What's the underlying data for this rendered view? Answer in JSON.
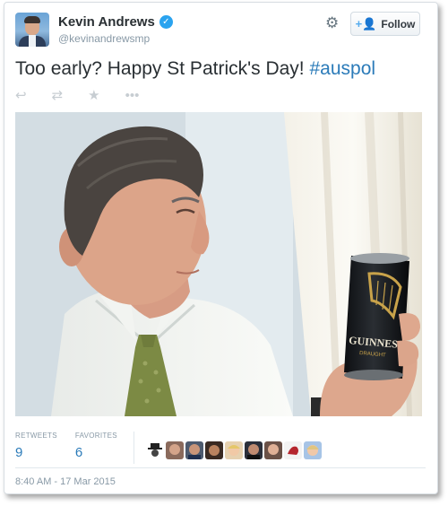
{
  "author": {
    "display_name": "Kevin Andrews",
    "handle": "@kevinandrewsmp",
    "verified_icon": "verified-badge-icon"
  },
  "header_actions": {
    "settings_icon": "gear-icon",
    "follow_label": "Follow"
  },
  "tweet": {
    "text": "Too early? Happy St Patrick's Day! ",
    "hashtag": "#auspol"
  },
  "action_icons": [
    "reply-icon",
    "retweet-icon",
    "favorite-icon",
    "more-icon"
  ],
  "photo": {
    "can_brand": "GUINNESS",
    "can_subtitle": "DRAUGHT"
  },
  "stats": {
    "retweets_label": "RETWEETS",
    "retweets_count": "9",
    "favorites_label": "FAVORITES",
    "favorites_count": "6"
  },
  "timestamp": "8:40 AM - 17 Mar 2015",
  "colors": {
    "link_blue": "#2b7bb9",
    "verified_blue": "#2aa3ef",
    "text_dark": "#292f33",
    "muted_gray": "#8899a6"
  }
}
